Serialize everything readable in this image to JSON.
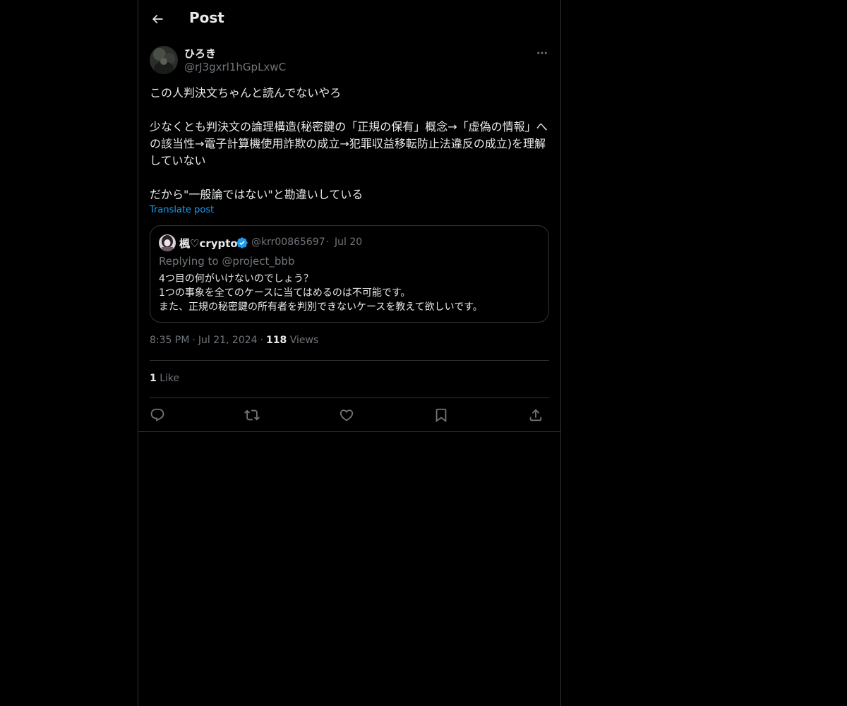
{
  "header": {
    "title": "Post"
  },
  "post": {
    "author": {
      "display_name": "ひろき",
      "handle": "@rJ3gxrl1hGpLxwC"
    },
    "paragraphs": [
      "この人判決文ちゃんと読んでないやろ",
      "少なくとも判決文の論理構造(秘密鍵の「正規の保有」概念→「虚偽の情報」への該当性→電子計算機使用詐欺の成立→犯罪収益移転防止法違反の成立)を理解していない",
      "だから\"一般論ではない\"と勘違いしている"
    ],
    "translate_label": "Translate post",
    "time": "8:35 PM",
    "date": "Jul 21, 2024",
    "views_count": "118",
    "views_label": "Views",
    "likes_count": "1",
    "likes_label": "Like"
  },
  "quote": {
    "display_name": "楓♡crypto",
    "handle": "@krr00865697",
    "dot": "·",
    "date": "Jul 20",
    "replying_prefix": "Replying to ",
    "replying_to": "@project_bbb",
    "lines": [
      "4つ目の何がいけないのでしょう？",
      "1つの事象を全てのケースに当てはめるのは不可能です。",
      "また、正規の秘密鍵の所有者を判別できないケースを教えて欲しいです。"
    ]
  },
  "separators": {
    "dot": "·"
  },
  "colors": {
    "background": "#000000",
    "text": "#e7e9ea",
    "muted": "#71767b",
    "accent": "#1d9bf0",
    "border": "#2f3336"
  },
  "icons": {
    "back": "arrow-left-icon",
    "more": "more-horizontal-icon",
    "verified": "verified-badge-icon",
    "reply": "reply-icon",
    "repost": "repost-icon",
    "like": "heart-icon",
    "bookmark": "bookmark-icon",
    "share": "share-icon"
  }
}
